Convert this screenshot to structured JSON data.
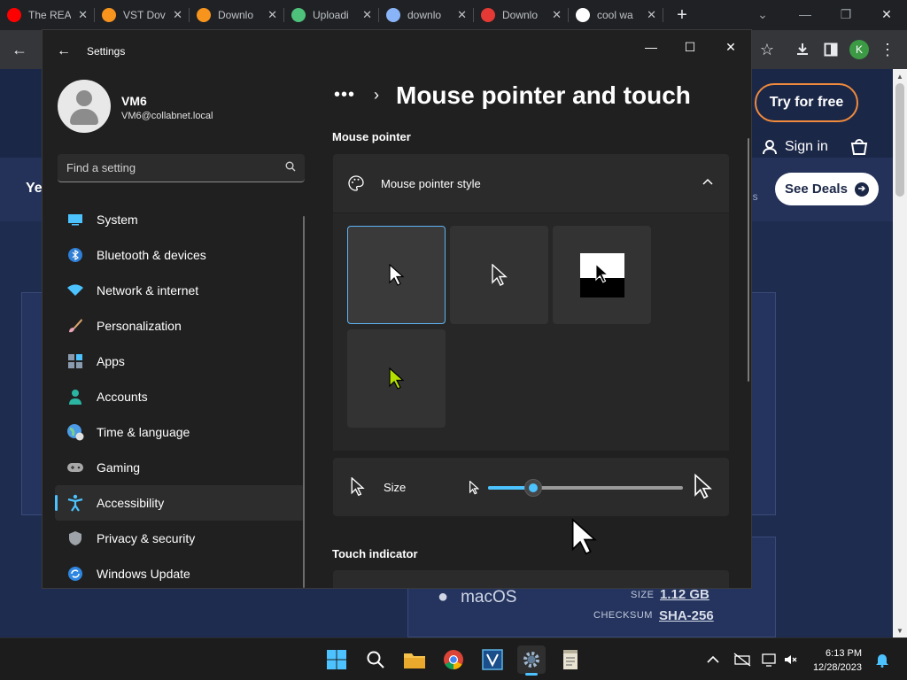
{
  "browser": {
    "tabs": [
      {
        "label": "The REA",
        "icon": "youtube-icon",
        "color": "#ff0000"
      },
      {
        "label": "VST Dov",
        "icon": "fl-studio-icon",
        "color": "#f7941d"
      },
      {
        "label": "Downlo",
        "icon": "fl-studio-icon",
        "color": "#f7941d"
      },
      {
        "label": "Uploadi",
        "icon": "cloud-upload-icon",
        "color": "#4ec27b"
      },
      {
        "label": "downlo",
        "icon": "globe-icon",
        "color": "#8ab4f8"
      },
      {
        "label": "Downlo",
        "icon": "red-logo-icon",
        "color": "#e53935"
      },
      {
        "label": "cool wa",
        "icon": "google-icon",
        "color": "#ffffff"
      }
    ],
    "close_glyph": "✕",
    "new_tab_glyph": "+",
    "profile_initial": "K"
  },
  "website": {
    "try_label": "Try for free",
    "signin_label": "Sign in",
    "deals_label": "See Deals",
    "partial_left": "Ye",
    "partial_right": "ls",
    "os_label": "macOS",
    "size_key": "SIZE",
    "size_value": "1.12 GB",
    "checksum_key": "CHECKSUM",
    "checksum_value": "SHA-256"
  },
  "settings": {
    "window_title": "Settings",
    "user": {
      "name": "VM6",
      "email": "VM6@collabnet.local"
    },
    "search_placeholder": "Find a setting",
    "nav": [
      {
        "label": "System",
        "icon": "system-icon",
        "active": false
      },
      {
        "label": "Bluetooth & devices",
        "icon": "bluetooth-icon",
        "active": false
      },
      {
        "label": "Network & internet",
        "icon": "wifi-icon",
        "active": false
      },
      {
        "label": "Personalization",
        "icon": "brush-icon",
        "active": false
      },
      {
        "label": "Apps",
        "icon": "apps-icon",
        "active": false
      },
      {
        "label": "Accounts",
        "icon": "person-icon",
        "active": false
      },
      {
        "label": "Time & language",
        "icon": "globe-clock-icon",
        "active": false
      },
      {
        "label": "Gaming",
        "icon": "gamepad-icon",
        "active": false
      },
      {
        "label": "Accessibility",
        "icon": "accessibility-icon",
        "active": true
      },
      {
        "label": "Privacy & security",
        "icon": "shield-icon",
        "active": false
      },
      {
        "label": "Windows Update",
        "icon": "update-icon",
        "active": false
      }
    ],
    "breadcrumb_dots": "•••",
    "page_title": "Mouse pointer and touch",
    "section_mouse": "Mouse pointer",
    "pointer_style_label": "Mouse pointer style",
    "pointer_styles": [
      "white",
      "black",
      "inverted",
      "custom"
    ],
    "selected_style": "white",
    "custom_color": "#b4e000",
    "accent": "#4cc2ff",
    "size_label": "Size",
    "size_value_fraction": 0.23,
    "section_touch": "Touch indicator"
  },
  "taskbar": {
    "time": "6:13 PM",
    "date": "12/28/2023"
  }
}
